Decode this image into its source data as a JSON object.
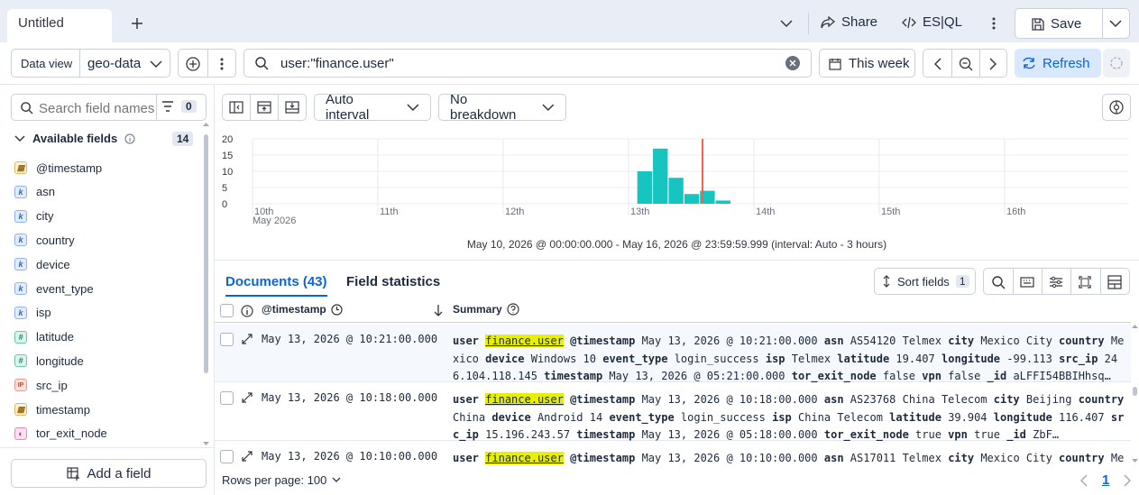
{
  "tabbar": {
    "tab_title": "Untitled",
    "share_label": "Share",
    "esql_label": "ES|QL",
    "save_label": "Save"
  },
  "querybar": {
    "data_view_label": "Data view",
    "data_view_value": "geo-data",
    "query": "user:\"finance.user\"",
    "time_label": "This week",
    "refresh_label": "Refresh"
  },
  "sidebar": {
    "search_placeholder": "Search field names",
    "filter_count": "0",
    "available_label": "Available fields",
    "available_count": "14",
    "fields": [
      {
        "name": "@timestamp",
        "type": "date"
      },
      {
        "name": "asn",
        "type": "keyword"
      },
      {
        "name": "city",
        "type": "keyword"
      },
      {
        "name": "country",
        "type": "keyword"
      },
      {
        "name": "device",
        "type": "keyword"
      },
      {
        "name": "event_type",
        "type": "keyword"
      },
      {
        "name": "isp",
        "type": "keyword"
      },
      {
        "name": "latitude",
        "type": "number"
      },
      {
        "name": "longitude",
        "type": "number"
      },
      {
        "name": "src_ip",
        "type": "ip"
      },
      {
        "name": "timestamp",
        "type": "date"
      },
      {
        "name": "tor_exit_node",
        "type": "boolean"
      }
    ],
    "add_field_label": "Add a field"
  },
  "histogram": {
    "interval_label": "Auto interval",
    "breakdown_label": "No breakdown",
    "footer": "May 10, 2026 @ 00:00:00.000 - May 16, 2026 @ 23:59:59.999 (interval: Auto - 3 hours)"
  },
  "chart_data": {
    "type": "bar",
    "yticks": [
      "20",
      "15",
      "10",
      "5",
      "0"
    ],
    "xticks": [
      "10th",
      "11th",
      "12th",
      "13th",
      "14th",
      "15th",
      "16th"
    ],
    "xsub": "May 2026",
    "ylim": [
      0,
      20
    ],
    "bar_color": "#16c5c0",
    "marker_color": "#e7664c",
    "bars": [
      {
        "day_offset": 3.125,
        "value": 10
      },
      {
        "day_offset": 3.25,
        "value": 17
      },
      {
        "day_offset": 3.375,
        "value": 8
      },
      {
        "day_offset": 3.5,
        "value": 3
      },
      {
        "day_offset": 3.625,
        "value": 4
      },
      {
        "day_offset": 3.75,
        "value": 1
      }
    ],
    "marker_offset": 3.59
  },
  "documents": {
    "tab_documents": "Documents (43)",
    "tab_stats": "Field statistics",
    "sort_label": "Sort fields",
    "sort_count": "1",
    "col_timestamp": "@timestamp",
    "col_summary": "Summary",
    "rows_per_page": "Rows per page: 100",
    "page": "1",
    "rows": [
      {
        "timestamp": "May 13, 2026 @ 10:21:00.000",
        "pairs": [
          [
            "user",
            "finance.user"
          ],
          [
            "@timestamp",
            "May 13, 2026 @ 10:21:00.000"
          ],
          [
            "asn",
            "AS54120 Telmex"
          ],
          [
            "city",
            "Mexico City"
          ],
          [
            "country",
            "Mexico"
          ],
          [
            "device",
            "Windows 10"
          ],
          [
            "event_type",
            "login_success"
          ],
          [
            "isp",
            "Telmex"
          ],
          [
            "latitude",
            "19.407"
          ],
          [
            "longitude",
            "-99.113"
          ],
          [
            "src_ip",
            "246.104.118.145"
          ],
          [
            "timestamp",
            "May 13, 2026 @ 05:21:00.000"
          ],
          [
            "tor_exit_node",
            "false"
          ],
          [
            "vpn",
            "false"
          ],
          [
            "_id",
            "aLFFI54BBIHhsq…"
          ]
        ]
      },
      {
        "timestamp": "May 13, 2026 @ 10:18:00.000",
        "pairs": [
          [
            "user",
            "finance.user"
          ],
          [
            "@timestamp",
            "May 13, 2026 @ 10:18:00.000"
          ],
          [
            "asn",
            "AS23768 China Telecom"
          ],
          [
            "city",
            "Beijing"
          ],
          [
            "country",
            "China"
          ],
          [
            "device",
            "Android 14"
          ],
          [
            "event_type",
            "login_success"
          ],
          [
            "isp",
            "China Telecom"
          ],
          [
            "latitude",
            "39.904"
          ],
          [
            "longitude",
            "116.407"
          ],
          [
            "src_ip",
            "15.196.243.57"
          ],
          [
            "timestamp",
            "May 13, 2026 @ 05:18:00.000"
          ],
          [
            "tor_exit_node",
            "true"
          ],
          [
            "vpn",
            "true"
          ],
          [
            "_id",
            "ZbF…"
          ]
        ]
      },
      {
        "timestamp": "May 13, 2026 @ 10:10:00.000",
        "pairs": [
          [
            "user",
            "finance.user"
          ],
          [
            "@timestamp",
            "May 13, 2026 @ 10:10:00.000"
          ],
          [
            "asn",
            "AS17011 Telmex"
          ],
          [
            "city",
            "Mexico City"
          ],
          [
            "country",
            "Mexico"
          ]
        ]
      }
    ]
  }
}
